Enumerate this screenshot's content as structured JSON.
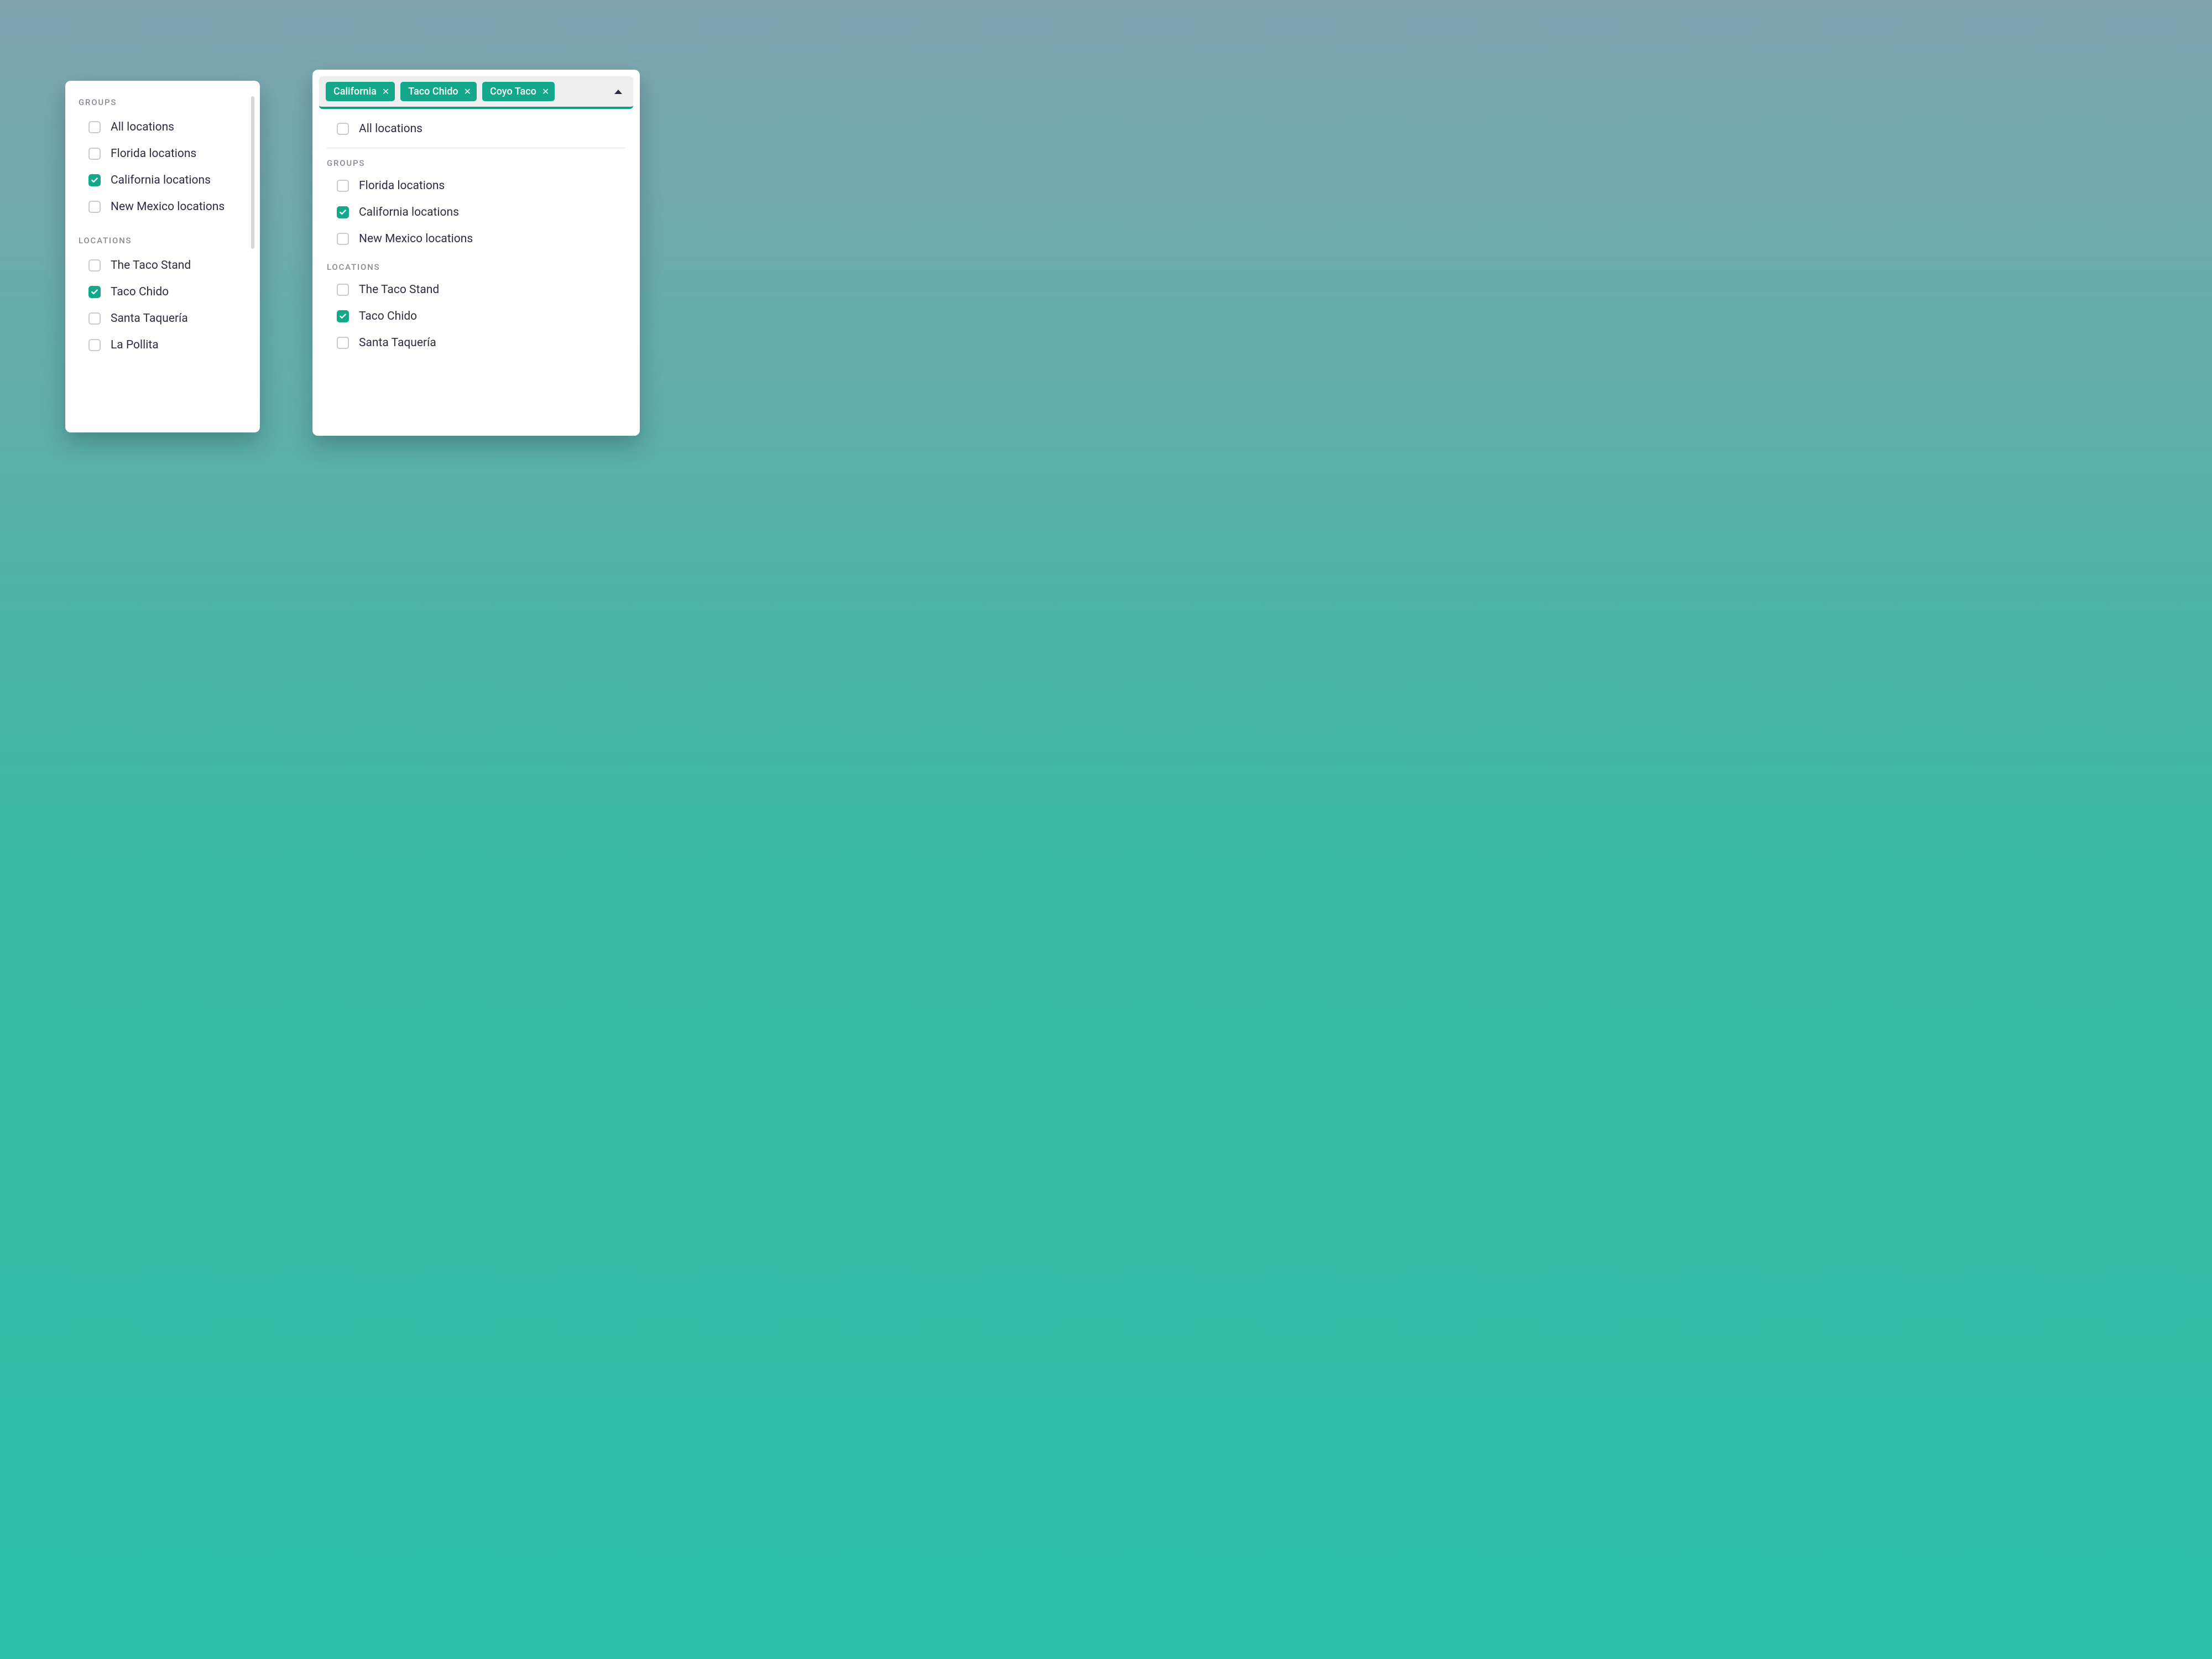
{
  "colors": {
    "accent": "#14a88b",
    "text": "#2d2c44",
    "muted": "#8a8c93"
  },
  "left": {
    "sections": {
      "groups_label": "GROUPS",
      "locations_label": "LOCATIONS"
    },
    "groups": [
      {
        "label": "All locations",
        "checked": false
      },
      {
        "label": "Florida locations",
        "checked": false
      },
      {
        "label": "California locations",
        "checked": true
      },
      {
        "label": "New Mexico locations",
        "checked": false
      }
    ],
    "locations": [
      {
        "label": "The Taco Stand",
        "checked": false
      },
      {
        "label": "Taco Chido",
        "checked": true
      },
      {
        "label": "Santa Taquería",
        "checked": false
      },
      {
        "label": "La Pollita",
        "checked": false
      }
    ]
  },
  "right": {
    "chips": [
      {
        "label": "California"
      },
      {
        "label": "Taco Chido"
      },
      {
        "label": "Coyo Taco"
      }
    ],
    "all_label": "All locations",
    "all_checked": false,
    "sections": {
      "groups_label": "GROUPS",
      "locations_label": "LOCATIONS"
    },
    "groups": [
      {
        "label": "Florida locations",
        "checked": false
      },
      {
        "label": "California locations",
        "checked": true
      },
      {
        "label": "New Mexico locations",
        "checked": false
      }
    ],
    "locations": [
      {
        "label": "The Taco Stand",
        "checked": false
      },
      {
        "label": "Taco Chido",
        "checked": true
      },
      {
        "label": "Santa Taquería",
        "checked": false
      }
    ]
  }
}
